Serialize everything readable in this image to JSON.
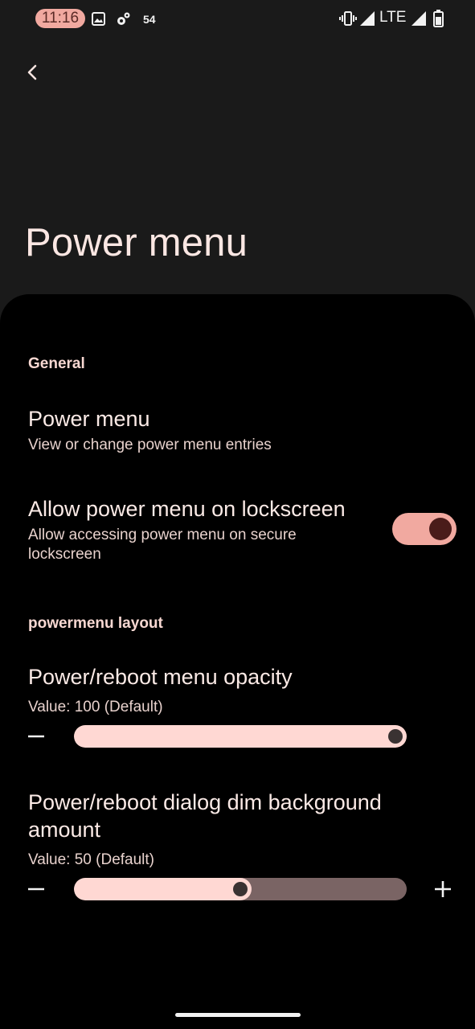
{
  "status_bar": {
    "time": "11:16",
    "notification_count": "54",
    "network": "LTE",
    "icons": [
      "image-icon",
      "settings-gear-icon",
      "vibrate-icon",
      "signal-icon",
      "signal-icon",
      "battery-icon"
    ]
  },
  "header": {
    "title": "Power menu"
  },
  "sections": {
    "general": {
      "header": "General",
      "power_menu": {
        "title": "Power menu",
        "summary": "View or change power menu entries"
      },
      "lockscreen": {
        "title": "Allow power menu on lockscreen",
        "summary_line1": "Allow accessing power menu on secure",
        "summary_line2": "lockscreen",
        "enabled": true
      }
    },
    "layout": {
      "header": "powermenu layout",
      "opacity": {
        "title": "Power/reboot menu opacity",
        "value_text": "Value: 100 (Default)",
        "value": 100,
        "max": 100
      },
      "dim": {
        "title_line1": "Power/reboot dialog dim background",
        "title_line2": "amount",
        "value_text": "Value: 50 (Default)",
        "value": 50,
        "max": 100
      }
    }
  },
  "colors": {
    "accent": "#f1a9a0",
    "slider_fill": "#ffd8d3",
    "slider_track": "#7a6464",
    "background": "#000000",
    "toolbar_background": "#1a1a1a"
  }
}
